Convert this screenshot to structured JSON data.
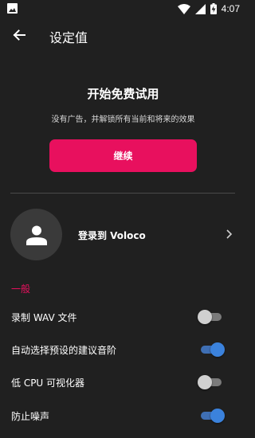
{
  "status_bar": {
    "time": "4:07"
  },
  "toolbar": {
    "title": "设定值"
  },
  "promo": {
    "title": "开始免费试用",
    "subtitle": "没有广告，并解锁所有当前和将来的效果",
    "continue_label": "继续",
    "accent_color": "#e8105e"
  },
  "account": {
    "login_label": "登录到 Voloco"
  },
  "general": {
    "header": "一般",
    "settings": [
      {
        "label": "录制 WAV 文件",
        "enabled": false
      },
      {
        "label": "自动选择预设的建议音阶",
        "enabled": true
      },
      {
        "label": "低 CPU 可视化器",
        "enabled": false
      },
      {
        "label": "防止噪声",
        "enabled": true
      }
    ]
  },
  "icons": {
    "status_left": "image-icon",
    "wifi": "wifi-icon",
    "signal": "signal-icon",
    "battery": "battery-charging-icon",
    "back": "arrow-back-icon",
    "avatar": "person-icon",
    "chevron": "chevron-right-icon"
  }
}
